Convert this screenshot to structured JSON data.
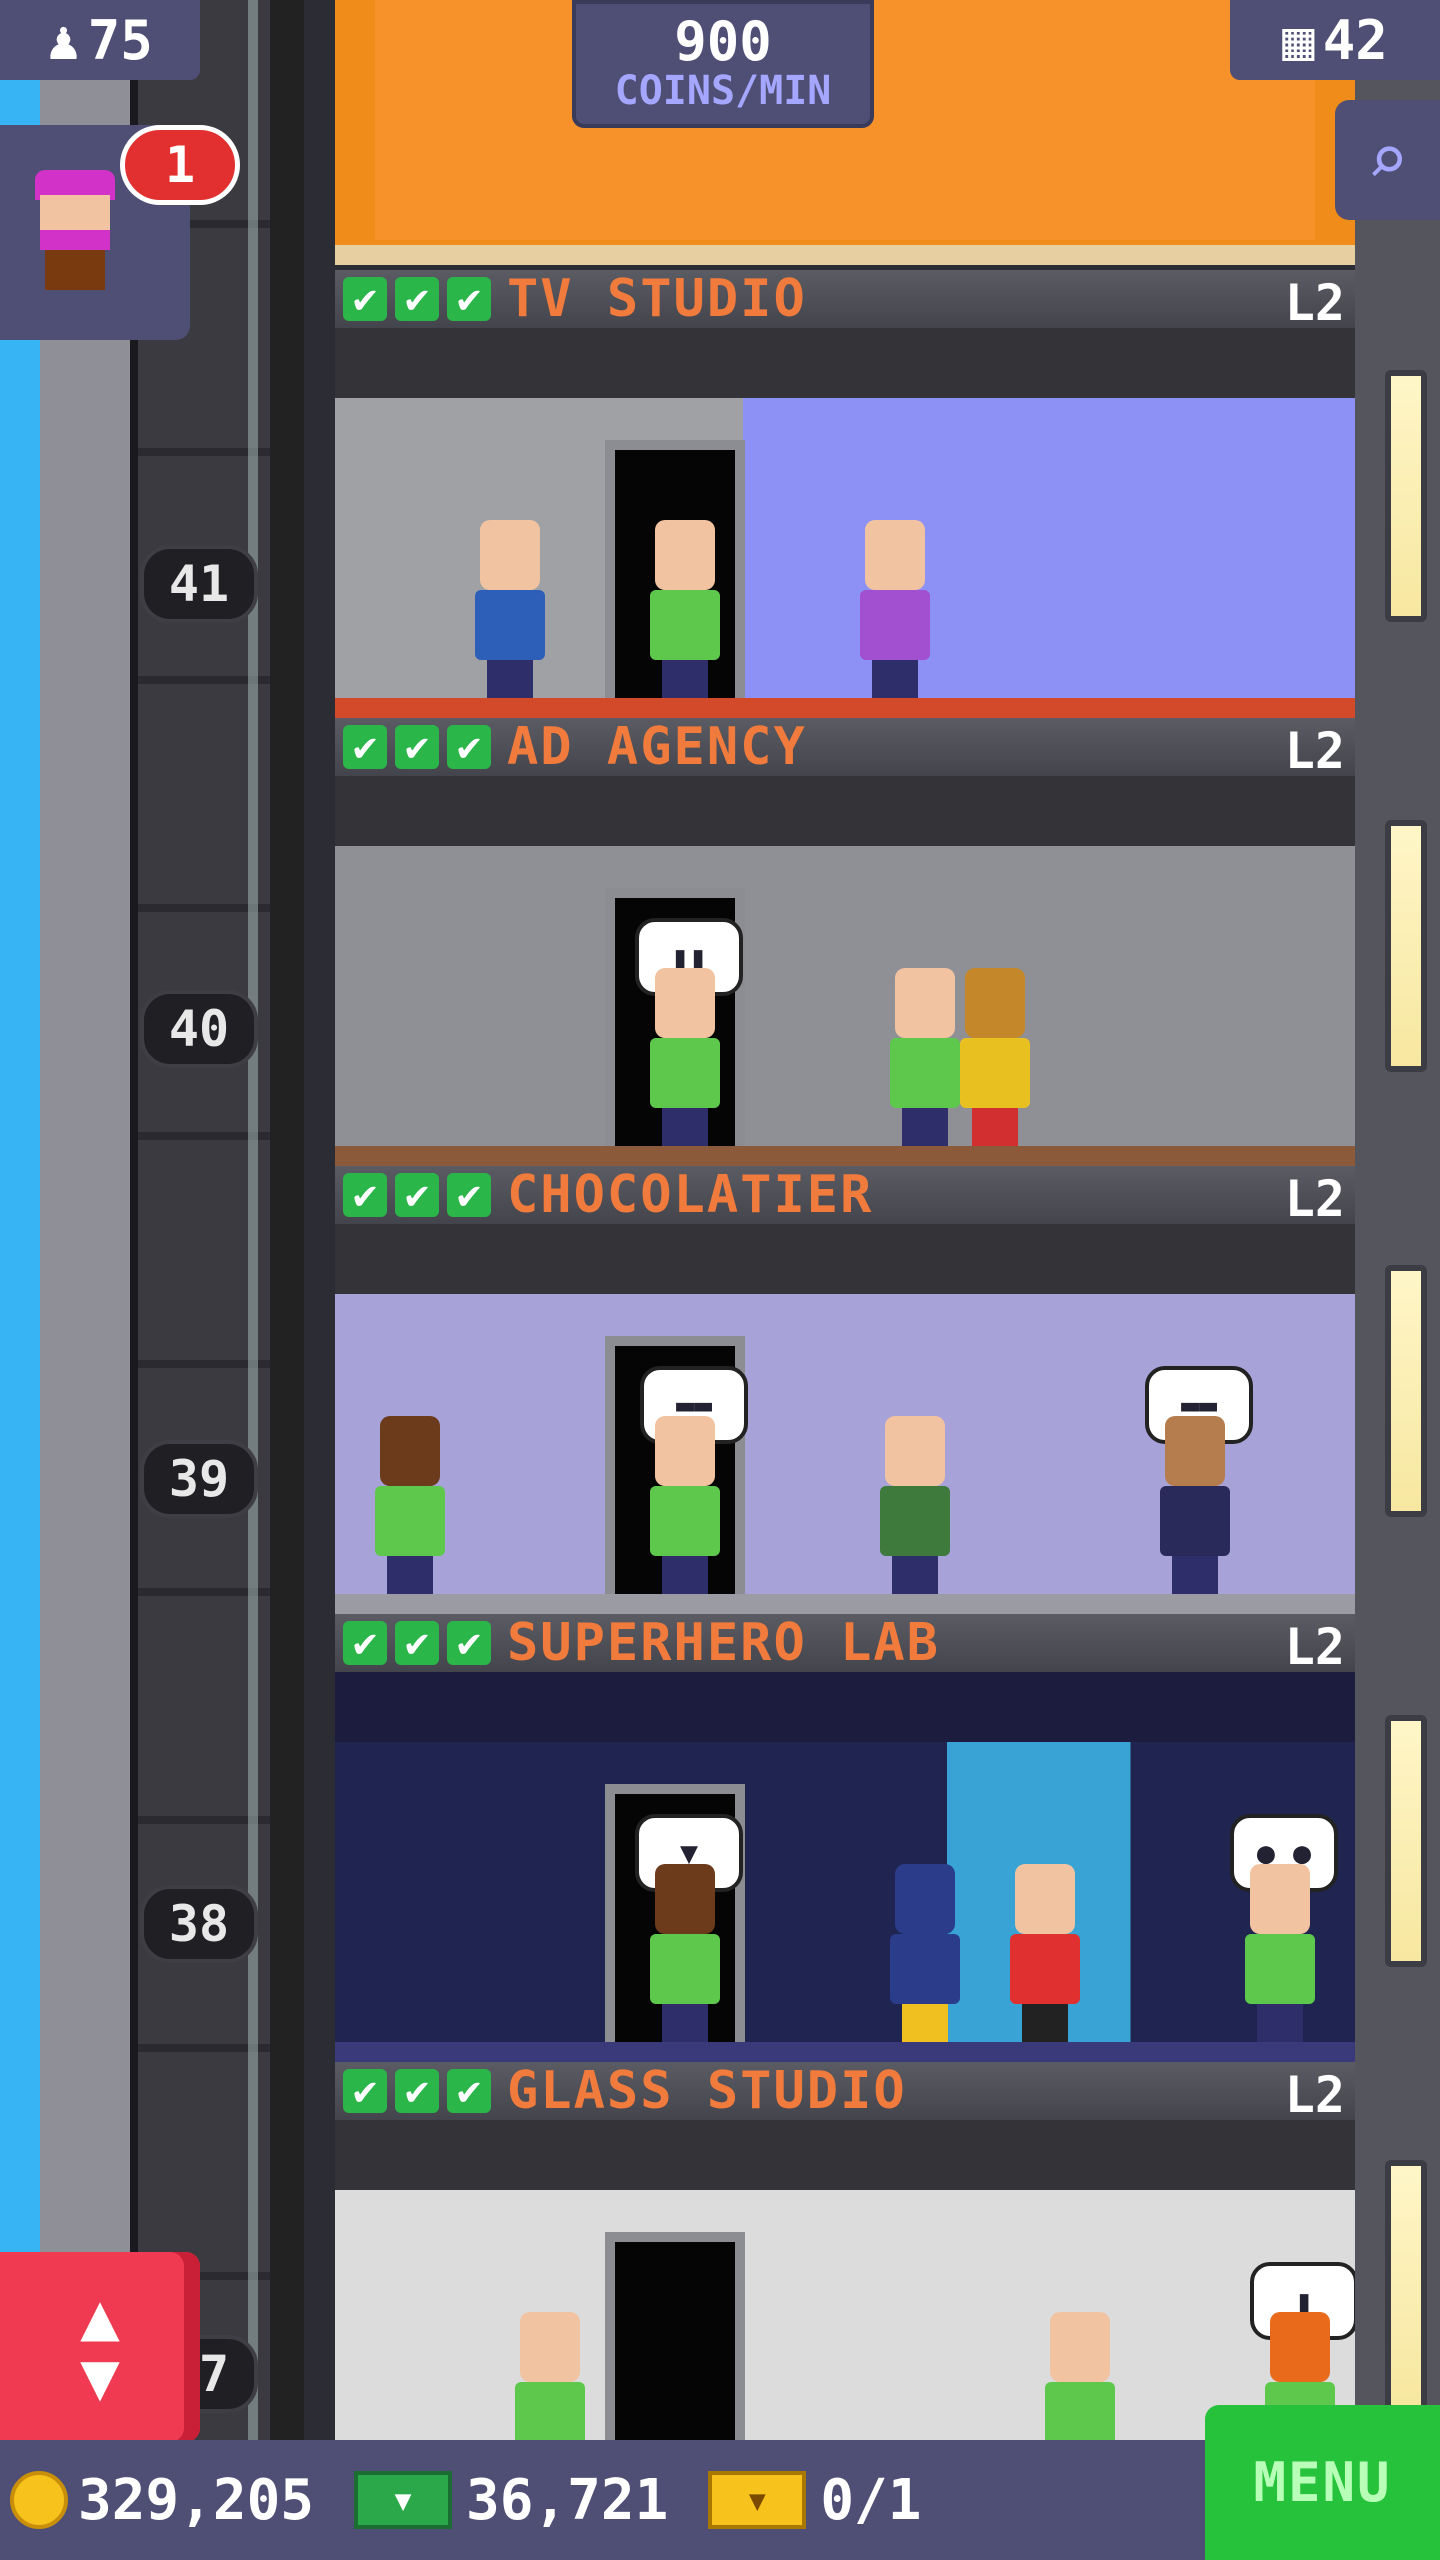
{
  "top_bar": {
    "population": "75",
    "coins_rate_value": "900",
    "coins_rate_unit": "COINS/MIN",
    "floors_count": "42"
  },
  "notification": {
    "badge": "1"
  },
  "floor_numbers": [
    "41",
    "40",
    "39",
    "38",
    "37"
  ],
  "floors": [
    {
      "name": "TV STUDIO",
      "level": "L2"
    },
    {
      "name": "AD AGENCY",
      "level": "L2"
    },
    {
      "name": "CHOCOLATIER",
      "level": "L2"
    },
    {
      "name": "SUPERHERO LAB",
      "level": "L2"
    },
    {
      "name": "GLASS STUDIO",
      "level": "L2"
    }
  ],
  "bottom_bar": {
    "coins": "329,205",
    "bux": "36,721",
    "tickets": "0/1",
    "menu_label": "MENU"
  },
  "colors": {
    "ui_panel": "#4f4f76",
    "floor_name": "#f07b3c",
    "check_green": "#2bb64a",
    "menu_green": "#27c23b",
    "elevator_red": "#ef3a52"
  }
}
